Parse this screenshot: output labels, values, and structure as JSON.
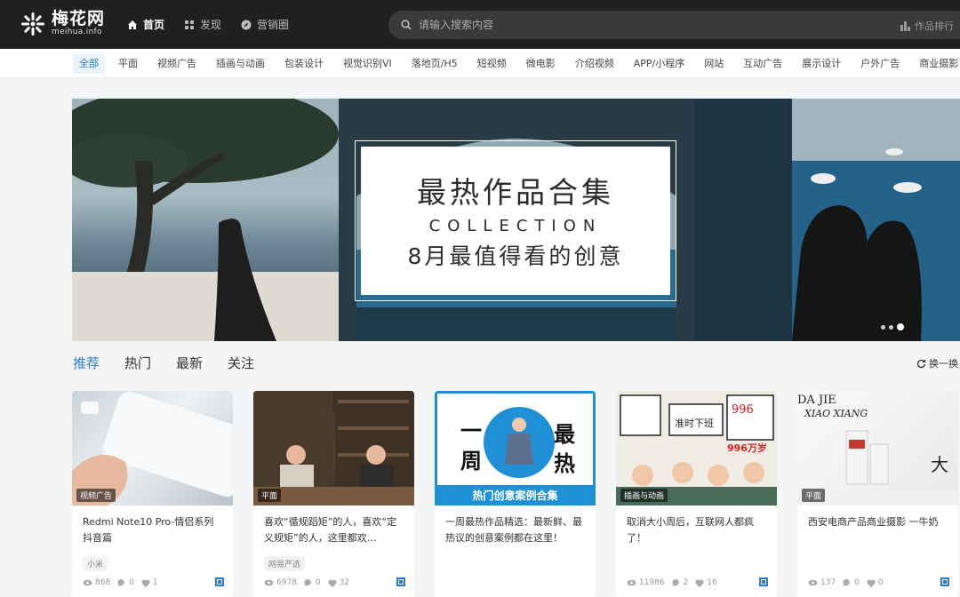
{
  "brand": {
    "name_cn": "梅花网",
    "name_en": "meihua.info"
  },
  "top_nav": [
    {
      "label": "首页",
      "icon": "home-icon"
    },
    {
      "label": "发现",
      "icon": "grid-icon"
    },
    {
      "label": "营销圈",
      "icon": "compass-icon"
    }
  ],
  "search": {
    "placeholder": "请输入搜索内容"
  },
  "rank_link": "作品排行",
  "categories": [
    "全部",
    "平面",
    "视频广告",
    "插画与动画",
    "包装设计",
    "视觉识别VI",
    "落地页/H5",
    "短视频",
    "微电影",
    "介绍视频",
    "APP/小程序",
    "网站",
    "互动广告",
    "展示设计",
    "户外广告",
    "商业摄影"
  ],
  "banner": {
    "title": "最热作品合集",
    "subtitle": "COLLECTION",
    "desc": "8月最值得看的创意"
  },
  "feed_tabs": [
    "推荐",
    "热门",
    "最新",
    "关注"
  ],
  "refresh_label": "换一换",
  "cards": [
    {
      "tag": "视频广告",
      "title": "Redmi Note10 Pro-情侣系列 抖音篇",
      "label": "小米",
      "views": "868",
      "comments": "0",
      "likes": "1"
    },
    {
      "tag": "平面",
      "title": "喜欢“循规蹈矩”的人，喜欢“定义规矩”的人，这里都欢…",
      "label": "网易严选",
      "views": "6978",
      "comments": "0",
      "likes": "32"
    },
    {
      "tag": "",
      "title": "一周最热作品精选：最新鲜、最热议的创意案例都在这里！",
      "label": "",
      "views": "",
      "comments": "",
      "likes": "",
      "thumb_text_a": "一",
      "thumb_text_b": "周",
      "thumb_text_c": "最",
      "thumb_text_d": "热",
      "thumb_caption": "热门创意案例合集"
    },
    {
      "tag": "插画与动画",
      "title": "取消大小周后，互联网人都疯了！",
      "label": "",
      "views": "11986",
      "comments": "2",
      "likes": "16",
      "thumb_text": "996万岁"
    },
    {
      "tag": "平面",
      "title": "西安电商产品商业摄影 一牛奶",
      "label": "",
      "views": "137",
      "comments": "0",
      "likes": "0",
      "thumb_text_a": "DA JIE",
      "thumb_text_b": "XIAO XIANG"
    }
  ],
  "colors": {
    "accent": "#2a7bd4",
    "topbar": "#202020"
  }
}
